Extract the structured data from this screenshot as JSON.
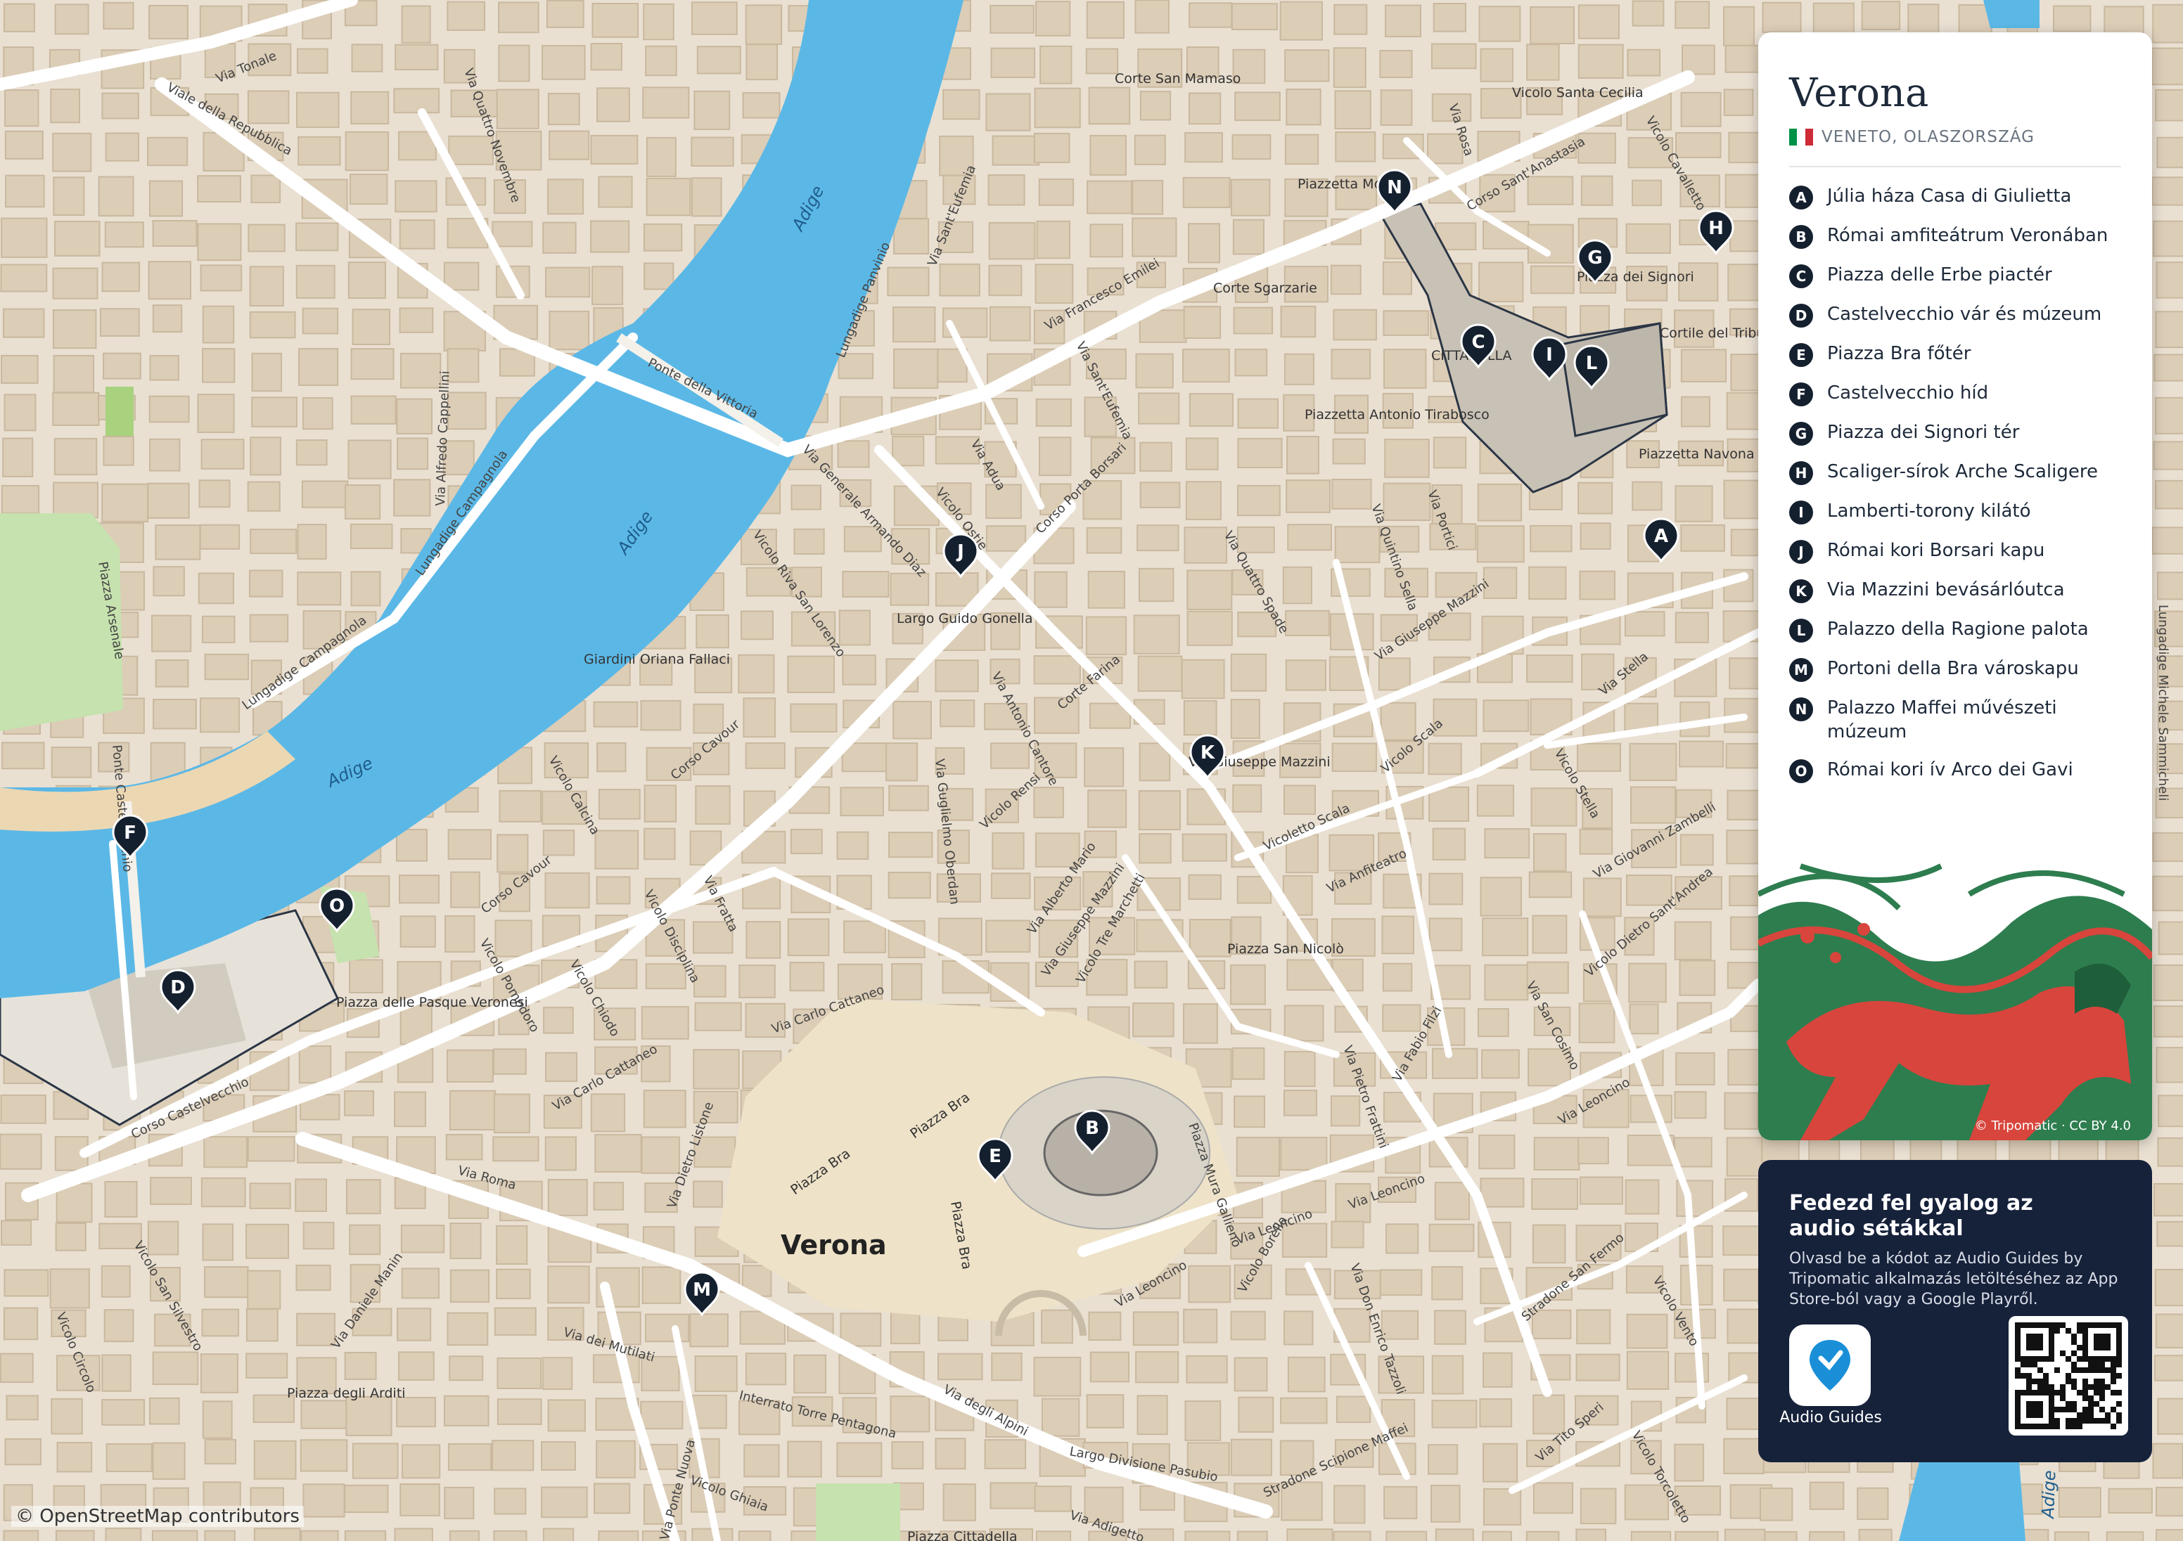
{
  "map": {
    "city_label": "Verona",
    "credit": "© OpenStreetMap contributors",
    "colors": {
      "land": "#e9e0d2",
      "water": "#5bb8e6",
      "park": "#c9e3b0",
      "road": "#ffffff",
      "block": "#d9cbb6",
      "poi_area": "#bfbab2"
    },
    "water_labels": [
      "Adige",
      "Adige",
      "Adige",
      "Adige",
      "Adige"
    ],
    "place_labels": [
      "Corte San Mamaso",
      "Corte Sgarzarie",
      "Piazzetta Monte",
      "Vicolo Santa Cecilia",
      "Piazza dei Signori",
      "Cortile del Tribunale",
      "Piazzetta Antonio Tirabosco",
      "Piazzetta Navona",
      "CITTADELLA",
      "Largo Guido Gonella",
      "Giardini Oriana Fallaci",
      "Via Giuseppe Mazzini",
      "Piazza San Nicolò",
      "Piazza delle Pasque Veronesi",
      "Piazza degli Arditi",
      "Piazza Bra",
      "Piazza Bra",
      "Piazza Bra",
      "Piazza Cittadella"
    ],
    "street_labels": [
      "Via Tonale",
      "Viale della Repubblica",
      "Via Quattro Novembre",
      "Lungadige Panvinio",
      "Via Sant'Eufemia",
      "Ponte della Vittoria",
      "Via Francesco Emilei",
      "Via Sant'Eufemia",
      "Corso Sant'Anastasia",
      "Via Rosa",
      "Vicolo Cavalletto",
      "Via Alfredo Cappellini",
      "Lungadige Campagnola",
      "Via Generale Armando Diaz",
      "Via Adua",
      "Vicolo Ostie",
      "Corso Porta Borsari",
      "Via Quattro Spade",
      "Via Quintino Sella",
      "Via Portici",
      "Via Giuseppe Mazzini",
      "Via Stella",
      "Vicolo Riva San Lorenzo",
      "Piazza Arsenale",
      "Lungadige Campagnola",
      "Corso Cavour",
      "Via Antonio Cantore",
      "Corte Farina",
      "Vicolo Calcina",
      "Vicolo Rensi",
      "Via Guglielmo Oberdan",
      "Via Fratta",
      "Vicolo Disciplina",
      "Corso Cavour",
      "Vicolo Pomodoro",
      "Vicolo Chiodo",
      "Via Alberto Mario",
      "Via Giuseppe Mazzini",
      "Vicolo Tre Marchetti",
      "Vicoletto Scala",
      "Vicolo Scala",
      "Via Anfiteatro",
      "Vicolo Stella",
      "Via Giovanni Zambelli",
      "Vicolo Dietro Sant'Andrea",
      "Via San Cosimo",
      "Via Fabio Filzi",
      "Via Pietro Frattini",
      "Via Leoncino",
      "Via Carlo Cattaneo",
      "Via Carlo Cattaneo",
      "Via Dietro Listone",
      "Corso Castelvecchio",
      "Via Roma",
      "Vicolo San Silvestro",
      "Via Daniele Manin",
      "Vicolo Circolo",
      "Via dei Mutilati",
      "Interrato Torre Pentagona",
      "Via degli Alpini",
      "Largo Divisione Pasubio",
      "Vicolo Ghiaia",
      "Via Adigetto",
      "Stradone Scipione Maffei",
      "Via Tito Speri",
      "Vicolo Torcoletto",
      "Vicolo Borella",
      "Via Don Enrico Tazzoli",
      "Stradone San Fermo",
      "Vicolo Vento",
      "Via Leoncino",
      "Via Leoncino",
      "Via Leoncino",
      "Piazza Mura Gallieno",
      "Lungadige Michele Sammicheli",
      "Ponte Castelvecchio",
      "Via Ponte Nuova",
      "Stradone San..."
    ],
    "pins": [
      {
        "letter": "A",
        "color": "#15202f"
      },
      {
        "letter": "B",
        "color": "#15202f"
      },
      {
        "letter": "C",
        "color": "#15202f"
      },
      {
        "letter": "D",
        "color": "#15202f"
      },
      {
        "letter": "E",
        "color": "#15202f"
      },
      {
        "letter": "F",
        "color": "#15202f"
      },
      {
        "letter": "G",
        "color": "#15202f"
      },
      {
        "letter": "H",
        "color": "#15202f"
      },
      {
        "letter": "I",
        "color": "#15202f"
      },
      {
        "letter": "J",
        "color": "#15202f"
      },
      {
        "letter": "K",
        "color": "#15202f"
      },
      {
        "letter": "L",
        "color": "#15202f"
      },
      {
        "letter": "M",
        "color": "#15202f"
      },
      {
        "letter": "N",
        "color": "#15202f"
      },
      {
        "letter": "O",
        "color": "#15202f"
      }
    ]
  },
  "panel": {
    "title": "Verona",
    "subtitle": "VENETO, OLASZORSZÁG",
    "flag_colors": [
      "#009246",
      "#ffffff",
      "#ce2b37"
    ],
    "items": [
      {
        "letter": "A",
        "name": "Júlia háza Casa di Giulietta"
      },
      {
        "letter": "B",
        "name": "Római amfiteátrum Veronában"
      },
      {
        "letter": "C",
        "name": "Piazza delle Erbe piactér"
      },
      {
        "letter": "D",
        "name": "Castelvecchio vár és múzeum"
      },
      {
        "letter": "E",
        "name": "Piazza Bra főtér"
      },
      {
        "letter": "F",
        "name": "Castelvecchio híd"
      },
      {
        "letter": "G",
        "name": "Piazza dei Signori tér"
      },
      {
        "letter": "H",
        "name": "Scaliger-sírok Arche Scaligere"
      },
      {
        "letter": "I",
        "name": "Lamberti-torony kilátó"
      },
      {
        "letter": "J",
        "name": "Római kori Borsari kapu"
      },
      {
        "letter": "K",
        "name": "Via Mazzini bevásárlóutca"
      },
      {
        "letter": "L",
        "name": "Palazzo della Ragione palota"
      },
      {
        "letter": "M",
        "name": "Portoni della Bra városkapu"
      },
      {
        "letter": "N",
        "name": "Palazzo Maffei művészeti múzeum"
      },
      {
        "letter": "O",
        "name": "Római kori ív Arco dei Gavi"
      }
    ],
    "art_credit": "© Tripomatic · CC BY 4.0",
    "art_colors": [
      "#2e7d4f",
      "#d8453c",
      "#ffffff"
    ]
  },
  "promo": {
    "title": "Fedezd fel gyalog az audio sétákkal",
    "text": "Olvasd be a kódot az Audio Guides by Tripomatic alkalmazás letöltéséhez az App Store-ból vagy a Google Playről.",
    "app_label": "Audio Guides",
    "app_icon": "location-pin-icon",
    "qr_icon": "qr-code-icon",
    "colors": {
      "bg": "#16213a",
      "accent": "#1a8fd8"
    }
  }
}
